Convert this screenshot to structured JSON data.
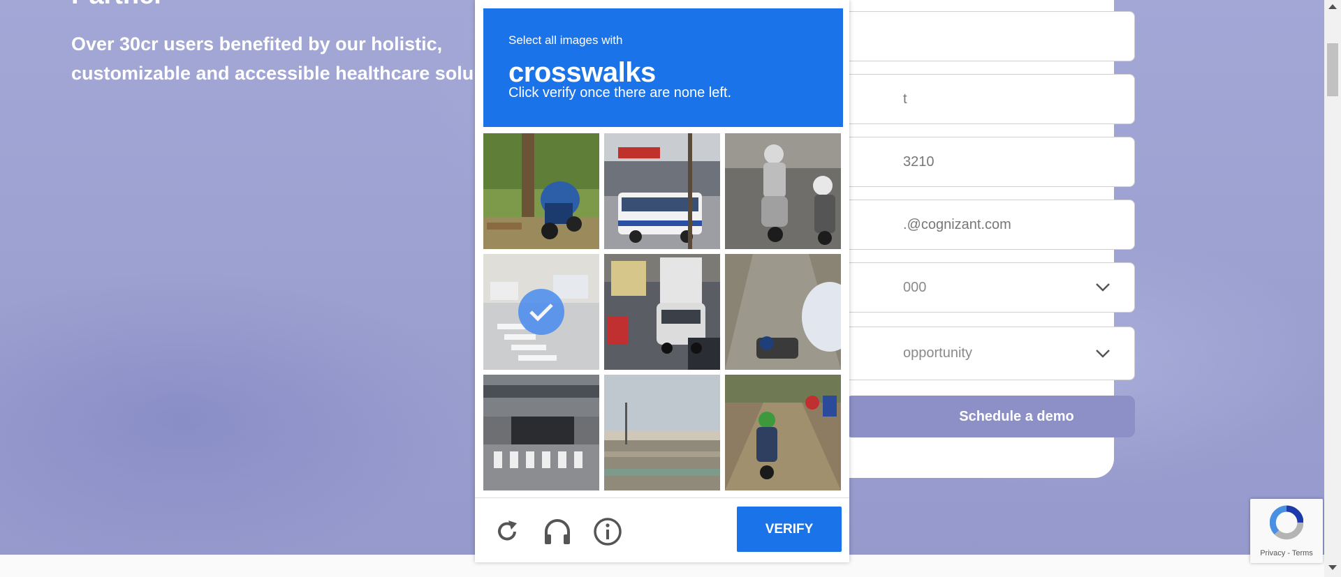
{
  "hero": {
    "title": "Partner",
    "subtitle": "Over 30cr users benefited by our holistic, customizable and accessible healthcare solu"
  },
  "form": {
    "fields": [
      {
        "value": ""
      },
      {
        "value": "t"
      },
      {
        "value": "3210"
      },
      {
        "value": ".@cognizant.com"
      }
    ],
    "selects": [
      {
        "selected": "000"
      },
      {
        "selected": "opportunity"
      }
    ],
    "submit_label": "Schedule a demo"
  },
  "captcha": {
    "instruction": "Select all images with",
    "target": "crosswalks",
    "hint": "Click verify once there are none left.",
    "tiles": [
      {
        "subject": "motorbike-by-tree",
        "selected": false
      },
      {
        "subject": "bus-at-storefront",
        "selected": false
      },
      {
        "subject": "scooter-riders",
        "selected": false
      },
      {
        "subject": "crosswalk-street",
        "selected": true
      },
      {
        "subject": "traffic-truck-car",
        "selected": false
      },
      {
        "subject": "road-mirror",
        "selected": false
      },
      {
        "subject": "crosswalk-building",
        "selected": false
      },
      {
        "subject": "bridge-overpass",
        "selected": false
      },
      {
        "subject": "motorbike-road",
        "selected": false
      }
    ],
    "verify_label": "VERIFY",
    "icons": [
      "reload-icon",
      "audio-icon",
      "info-icon"
    ]
  },
  "badge": {
    "links": "Privacy - Terms"
  },
  "colors": {
    "accent": "#1a73e8",
    "demo_button": "#8c90c6"
  }
}
